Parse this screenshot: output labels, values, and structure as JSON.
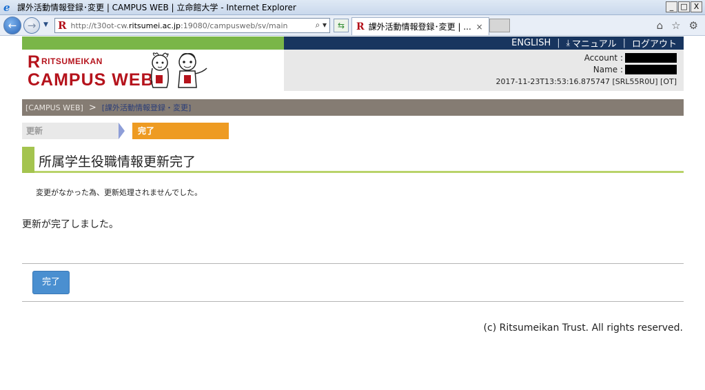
{
  "window": {
    "title": "課外活動情報登録･変更 | CAMPUS WEB | 立命館大学 - Internet Explorer",
    "minimize": "_",
    "maximize": "□",
    "close": "X"
  },
  "browser": {
    "url_host_prefix": "http://t30ot-cw.",
    "url_domain": "ritsumei.ac.jp",
    "url_rest": ":19080/campusweb/sv/main",
    "tab_label": "課外活動情報登録･変更 | ...",
    "tab_close": "×",
    "icons": [
      "back-icon",
      "forward-icon",
      "search-icon",
      "refresh-icon",
      "home-icon",
      "favorites-icon",
      "settings-icon"
    ]
  },
  "header": {
    "nav": {
      "english": "ENGLISH",
      "sep1": "|",
      "manual": "マニュアル",
      "sep2": "|",
      "logout": "ログアウト"
    },
    "logo": {
      "r": "R",
      "small": "RITSUMEIKAN",
      "big": "CAMPUS WEB"
    },
    "account_label": "Account :",
    "name_label": "Name :",
    "timestamp": "2017-11-23T13:53:16.875747 [SRL55R0U] [OT]"
  },
  "breadcrumb": {
    "home": "[CAMPUS WEB]",
    "sep": ">",
    "current": "[課外活動情報登録・変更]"
  },
  "steps": {
    "previous": "更新",
    "current": "完了"
  },
  "main": {
    "heading": "所属学生役職情報更新完了",
    "notice": "変更がなかった為、更新処理されませんでした。",
    "message": "更新が完了しました。",
    "done_button": "完了"
  },
  "footer": {
    "copyright": "(c) Ritsumeikan Trust. All rights reserved."
  },
  "colors": {
    "brand_red": "#b5131c",
    "nav_navy": "#18355f",
    "green": "#7ab648",
    "breadcrumb_bg": "#857c73",
    "step_orange": "#ee9b22",
    "button_blue": "#4a8fd0"
  }
}
